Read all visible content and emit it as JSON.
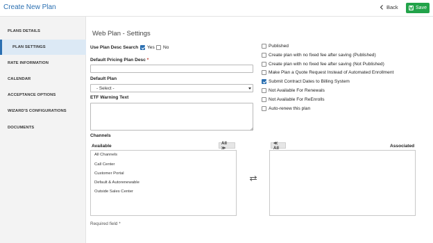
{
  "header": {
    "title": "Create New Plan",
    "back_label": "Back",
    "save_label": "Save"
  },
  "sidebar": {
    "items": [
      {
        "label": "PLANS DETAILS",
        "active": false
      },
      {
        "label": "PLAN SETTINGS",
        "active": true
      },
      {
        "label": "RATE INFORMATION",
        "active": false
      },
      {
        "label": "CALENDAR",
        "active": false
      },
      {
        "label": "ACCEPTANCE OPTIONS",
        "active": false
      },
      {
        "label": "WIZARD'S CONFIGURATIONS",
        "active": false
      },
      {
        "label": "DOCUMENTS",
        "active": false
      }
    ]
  },
  "main": {
    "section_title": "Web Plan - Settings",
    "use_plan_desc_search": {
      "label": "Use Plan Desc Search",
      "yes_label": "Yes",
      "no_label": "No",
      "yes_checked": true,
      "no_checked": false
    },
    "default_pricing_plan_desc": {
      "label": "Default Pricing Plan Desc",
      "required_mark": "*",
      "value": ""
    },
    "default_plan": {
      "label": "Default Plan",
      "selected": "- Select -"
    },
    "etf_warning_text": {
      "label": "ETF Warning Text",
      "value": ""
    },
    "options": [
      {
        "label": "Published",
        "checked": false
      },
      {
        "label": "Create plan with no fixed fee after saving (Published)",
        "checked": false
      },
      {
        "label": "Create plan with no fixed fee after saving (Not Published)",
        "checked": false
      },
      {
        "label": "Make Plan a Quote Request Instead of Automated Enrollment",
        "checked": false
      },
      {
        "label": "Submit Contract Dates to Billing System",
        "checked": true
      },
      {
        "label": "Not Available For Renewals",
        "checked": false
      },
      {
        "label": "Not Available For ReEnrolls",
        "checked": false
      },
      {
        "label": "Auto-renew this plan",
        "checked": false
      }
    ],
    "channels": {
      "label": "Channels",
      "available_label": "Available",
      "associated_label": "Associated",
      "all_right_label": "All ≫",
      "all_left_label": "≪ All",
      "available": [
        "All Channels",
        "Call Center",
        "Customer Portal",
        "Default & Autorenewable",
        "Outside Sales Center"
      ],
      "associated": []
    },
    "required_note": "Required field *"
  },
  "colors": {
    "accent": "#2a6fb1",
    "save": "#22a34a",
    "active_bg": "#dce9f5"
  }
}
